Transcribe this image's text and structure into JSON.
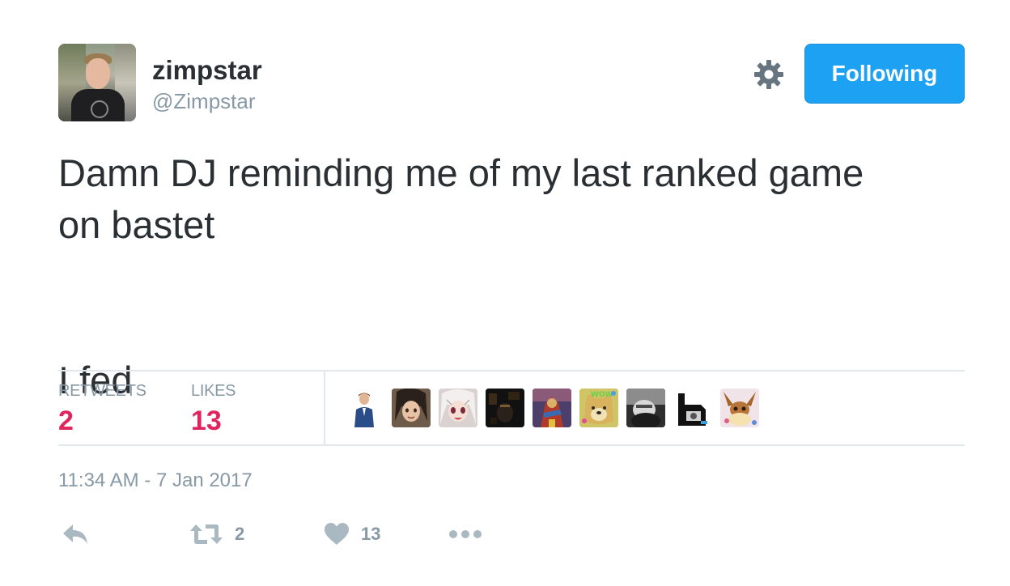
{
  "user": {
    "name": "zimpstar",
    "handle": "@Zimpstar"
  },
  "follow_button": {
    "label": "Following"
  },
  "tweet": {
    "text": "Damn DJ reminding me of my last ranked game\non bastet\n\n\nI fed"
  },
  "stats": {
    "retweets_label": "RETWEETS",
    "retweets_value": "2",
    "likes_label": "LIKES",
    "likes_value": "13"
  },
  "likers": [
    "liker-avatar-man-in-suit",
    "liker-avatar-anime-dark-hair",
    "liker-avatar-anime-white-hair",
    "liker-avatar-dark-scene",
    "liker-avatar-colorful-game-art",
    "liker-avatar-wow-doge",
    "liker-avatar-grey-figure",
    "liker-avatar-black-white-logo",
    "liker-avatar-eevee"
  ],
  "timestamp": "11:34 AM - 7 Jan 2017",
  "actions": {
    "retweet_count": "2",
    "like_count": "13"
  },
  "colors": {
    "brand_blue": "#1da1f2",
    "stat_red": "#e0245e",
    "muted_gray": "#8899a6",
    "text_dark": "#292f33",
    "icon_gray": "#aab8c2"
  }
}
